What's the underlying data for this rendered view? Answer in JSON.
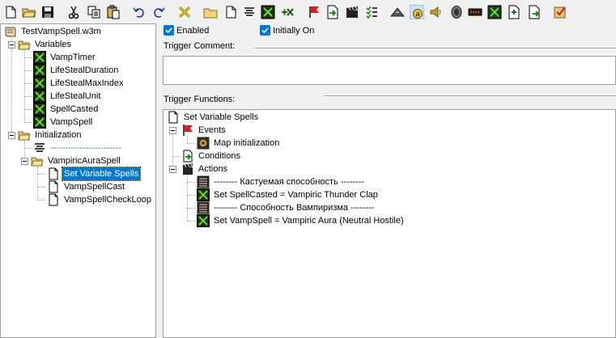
{
  "toolbar": {
    "buttons": [
      {
        "name": "new-icon"
      },
      {
        "name": "open-icon"
      },
      {
        "name": "save-icon"
      },
      {
        "name": "cut-icon"
      },
      {
        "name": "copy-icon"
      },
      {
        "name": "paste-icon"
      },
      {
        "name": "undo-icon"
      },
      {
        "name": "redo-icon"
      },
      {
        "name": "delete-icon"
      },
      {
        "name": "new-category-icon"
      },
      {
        "name": "new-trigger-icon"
      },
      {
        "name": "new-comment-icon"
      },
      {
        "name": "variables-icon"
      },
      {
        "name": "new-event-icon"
      },
      {
        "name": "new-condition-icon"
      },
      {
        "name": "new-action-icon"
      },
      {
        "name": "test-map-icon"
      },
      {
        "name": "terrain-editor-icon"
      },
      {
        "name": "trigger-editor-icon"
      },
      {
        "name": "sound-editor-icon"
      },
      {
        "name": "object-editor-icon"
      },
      {
        "name": "campaign-editor-icon"
      },
      {
        "name": "ai-editor-icon"
      },
      {
        "name": "object-manager-icon"
      },
      {
        "name": "import-manager-icon"
      },
      {
        "name": "quest-icon"
      }
    ]
  },
  "tree": {
    "root": "TestVampSpell.w3m",
    "variables_folder": "Variables",
    "variables": [
      "VampTimer",
      "LifeStealDuration",
      "LifeStealMaxIndex",
      "LifeStealUnit",
      "SpellCasted",
      "VampSpell"
    ],
    "init_folder": "Initialization",
    "separator_comment": "------------------------",
    "spell_folder": "VampiricAuraSpell",
    "triggers": [
      "Set Variable Spells",
      "VampSpellCast",
      "VampSpellCheckLoop"
    ]
  },
  "options": {
    "enabled_label": "Enabled",
    "enabled_checked": true,
    "initially_on_label": "Initially On",
    "initially_on_checked": true
  },
  "comment": {
    "label": "Trigger Comment:",
    "value": ""
  },
  "functions": {
    "label": "Trigger Functions:",
    "trigger_name": "Set Variable Spells",
    "events_label": "Events",
    "event_1": "Map initialization",
    "conditions_label": "Conditions",
    "actions_label": "Actions",
    "actions": [
      "-------- Кастуемая способность --------",
      "Set SpellCasted = Vampiric Thunder Clap",
      "-------- Способность Вампиризма --------",
      "Set VampSpell = Vampiric Aura (Neutral Hostile)"
    ]
  },
  "colors": {
    "selection": "#0078d7",
    "checkbox": "#0078d7",
    "variable_icon_bg": "#1f2a10",
    "variable_icon_fg": "#5fe02a"
  }
}
